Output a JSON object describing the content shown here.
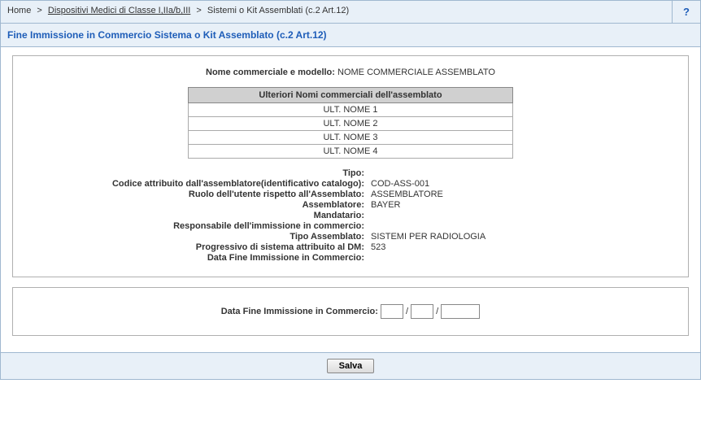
{
  "breadcrumb": {
    "home": "Home",
    "link": "Dispositivi Medici di Classe I,IIa/b,III",
    "current": "Sistemi o Kit Assemblati (c.2 Art.12)",
    "sep": ">"
  },
  "help": "?",
  "title": "Fine Immissione in Commercio Sistema o Kit Assemblato (c.2 Art.12)",
  "info": {
    "nome_label": "Nome commerciale e modello:",
    "nome_value": "NOME COMMERCIALE ASSEMBLATO",
    "ult_header": "Ulteriori Nomi commerciali dell'assemblato",
    "ult_names": [
      "ULT. NOME 1",
      "ULT. NOME 2",
      "ULT. NOME 3",
      "ULT. NOME 4"
    ],
    "fields": {
      "tipo_l": "Tipo:",
      "tipo_v": "",
      "cod_l": "Codice attribuito dall'assemblatore(identificativo catalogo):",
      "cod_v": "COD-ASS-001",
      "ruolo_l": "Ruolo dell'utente rispetto all'Assemblato:",
      "ruolo_v": "ASSEMBLATORE",
      "ass_l": "Assemblatore:",
      "ass_v": "BAYER",
      "mand_l": "Mandatario:",
      "mand_v": "",
      "resp_l": "Responsabile dell'immissione in commercio:",
      "resp_v": "",
      "tipoa_l": "Tipo Assemblato:",
      "tipoa_v": "SISTEMI PER RADIOLOGIA",
      "prog_l": "Progressivo di sistema attribuito al DM:",
      "prog_v": "523",
      "datafine_l": "Data Fine Immissione in Commercio:",
      "datafine_v": ""
    }
  },
  "dateform": {
    "label": "Data Fine Immissione in Commercio:",
    "sep": "/"
  },
  "footer": {
    "save": "Salva"
  }
}
